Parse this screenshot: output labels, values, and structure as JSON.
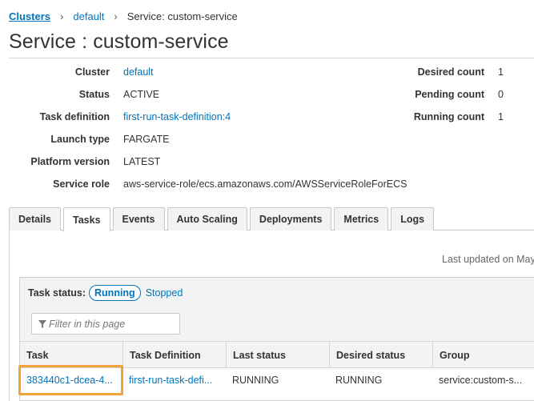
{
  "breadcrumb": {
    "items": [
      "Clusters",
      "default",
      "Service: custom-service"
    ],
    "separator": "›"
  },
  "page": {
    "title": "Service : custom-service"
  },
  "details": {
    "left": [
      {
        "label": "Cluster",
        "value": "default",
        "link": true
      },
      {
        "label": "Status",
        "value": "ACTIVE",
        "link": false
      },
      {
        "label": "Task definition",
        "value": "first-run-task-definition:4",
        "link": true
      },
      {
        "label": "Launch type",
        "value": "FARGATE",
        "link": false
      },
      {
        "label": "Platform version",
        "value": "LATEST",
        "link": false
      },
      {
        "label": "Service role",
        "value": "aws-service-role/ecs.amazonaws.com/AWSServiceRoleForECS",
        "link": false
      }
    ],
    "right": [
      {
        "label": "Desired count",
        "value": "1"
      },
      {
        "label": "Pending count",
        "value": "0"
      },
      {
        "label": "Running count",
        "value": "1"
      }
    ]
  },
  "tabs": [
    "Details",
    "Tasks",
    "Events",
    "Auto Scaling",
    "Deployments",
    "Metrics",
    "Logs"
  ],
  "active_tab": "Tasks",
  "tasks_panel": {
    "last_updated": "Last updated on May",
    "status_label": "Task status:",
    "status_running": "Running",
    "status_stopped": "Stopped",
    "filter_placeholder": "Filter in this page",
    "columns": [
      "Task",
      "Task Definition",
      "Last status",
      "Desired status",
      "Group"
    ],
    "rows": [
      [
        "383440c1-dcea-4...",
        "first-run-task-defi...",
        "RUNNING",
        "RUNNING",
        "service:custom-s..."
      ]
    ]
  },
  "colors": {
    "link": "#0073bb",
    "highlight": "#f0a33b",
    "header_bg": "#f2f3f3"
  }
}
